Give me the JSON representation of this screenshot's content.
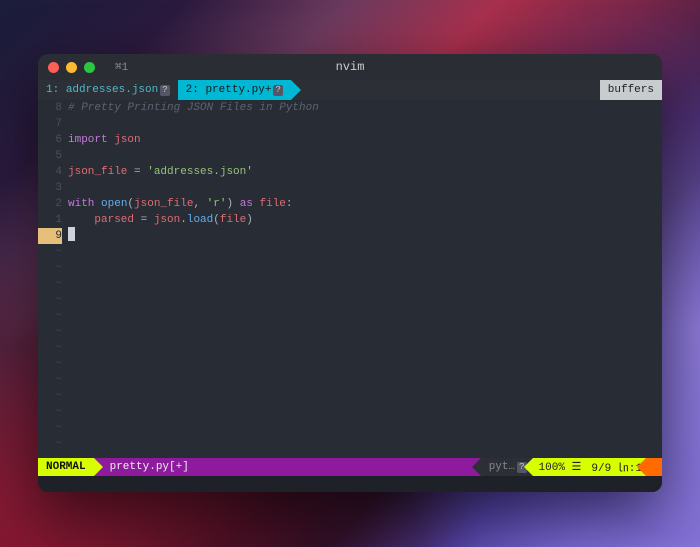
{
  "window": {
    "terminal_tab": "⌘1",
    "title": "nvim"
  },
  "bufferline": {
    "tabs": [
      {
        "index": "1:",
        "name": "addresses.json",
        "modified": "?",
        "active": false
      },
      {
        "index": "2:",
        "name": "pretty.py+",
        "modified": "?",
        "active": true
      }
    ],
    "right_label": "buffers"
  },
  "gutter": {
    "numbers": [
      "8",
      "7",
      "6",
      "5",
      "4",
      "3",
      "2",
      "1",
      "9"
    ],
    "current_index": 8
  },
  "code": {
    "lines": [
      {
        "t": "comment",
        "text": "# Pretty Printing JSON Files in Python"
      },
      {
        "t": "blank",
        "text": ""
      },
      {
        "t": "import",
        "kw": "import",
        "mod": "json"
      },
      {
        "t": "blank",
        "text": ""
      },
      {
        "t": "assign",
        "lhs": "json_file",
        "op": " = ",
        "str": "'addresses.json'"
      },
      {
        "t": "blank",
        "text": ""
      },
      {
        "t": "with",
        "kw1": "with",
        "fn": "open",
        "args_a": "json_file",
        "args_b": "'r'",
        "kw2": "as",
        "var": "file",
        "colon": ":"
      },
      {
        "t": "assign2",
        "indent": "    ",
        "lhs": "parsed",
        "op": " = ",
        "obj": "json",
        "dot": ".",
        "fn": "load",
        "arg": "file"
      },
      {
        "t": "cursor",
        "text": ""
      }
    ]
  },
  "statusline": {
    "mode": "NORMAL",
    "file": "pretty.py[+]",
    "filetype": "pyt…",
    "filetype_icon": "?",
    "percent": "100% ☰",
    "position": "9/9 ㏑:1"
  }
}
